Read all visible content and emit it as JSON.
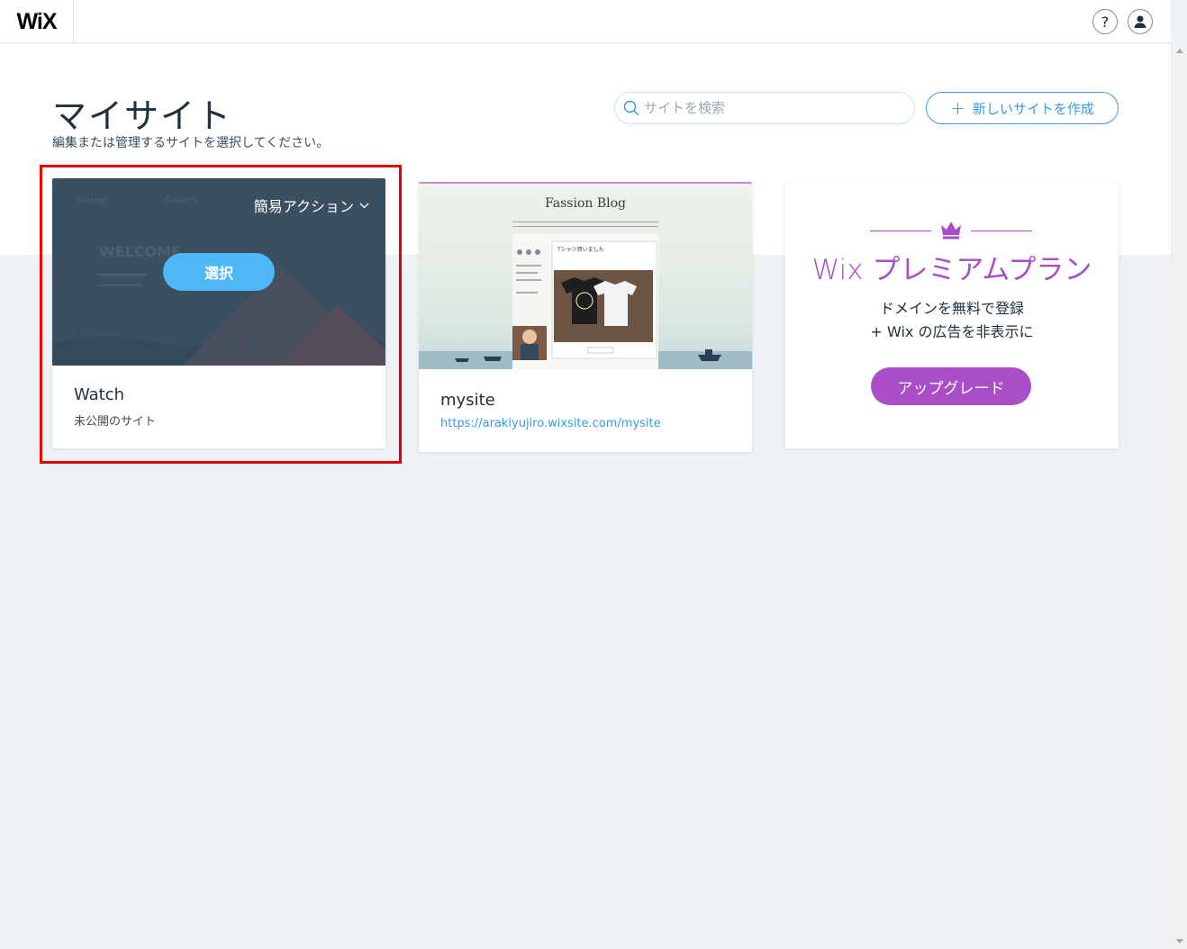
{
  "header": {
    "logo": "WiX",
    "help_glyph": "?"
  },
  "page": {
    "title": "マイサイト",
    "subtitle": "編集または管理するサイトを選択してください。"
  },
  "search": {
    "placeholder": "サイトを検索",
    "value": ""
  },
  "create_button": {
    "plus": "+",
    "label": "新しいサイトを作成"
  },
  "sites": [
    {
      "name": "Watch",
      "status": "未公開のサイト",
      "quick_actions_label": "簡易アクション",
      "select_label": "選択",
      "thumb": {
        "nav1": "Home",
        "nav2": "Gallery",
        "welcome": "WELCOME"
      }
    },
    {
      "name": "mysite",
      "url": "https://arakiyujiro.wixsite.com/mysite",
      "thumb": {
        "blog_title": "Fassion Blog",
        "post_title": "Tシャツ買いました"
      }
    }
  ],
  "premium": {
    "title": "Wix プレミアムプラン",
    "desc_line1": "ドメインを無料で登録",
    "desc_line2": "+ Wix の広告を非表示に",
    "button_label": "アップグレード"
  },
  "colors": {
    "accent": "#3899ec",
    "premium": "#aa4dc8",
    "highlight": "#e00000",
    "select_button": "#4eb7f5"
  },
  "icons": {
    "search": "search-icon",
    "help": "help-icon",
    "account": "account-icon",
    "crown": "crown-icon",
    "chevron": "chevron-down-icon"
  }
}
